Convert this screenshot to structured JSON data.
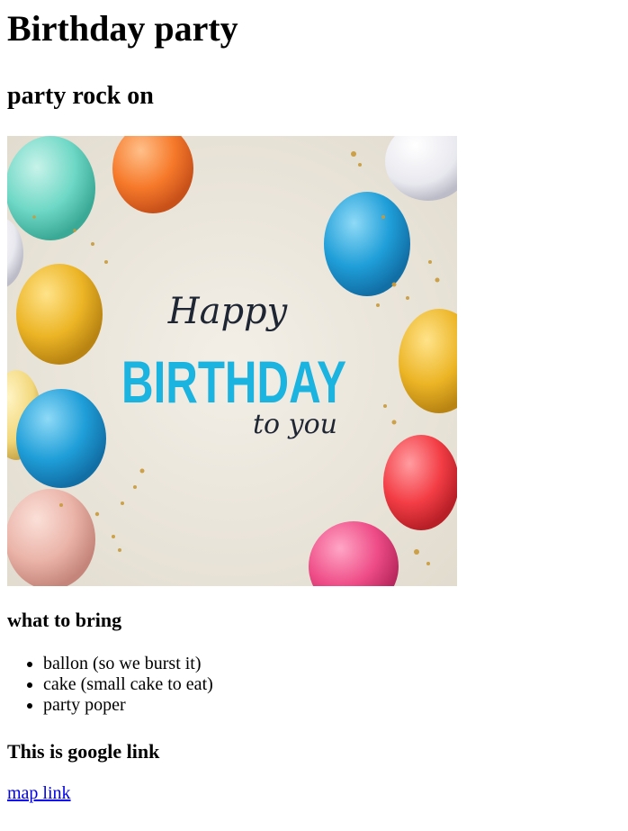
{
  "page": {
    "title": "Birthday party",
    "subtitle": "party rock on"
  },
  "hero_image": {
    "icon": "birthday-balloons-image",
    "text_happy": "Happy",
    "text_birthday": "BIRTHDAY",
    "text_to_you": "to you",
    "colors": {
      "background": "#ece6dc",
      "birthday_text": "#1bb3df",
      "teal": "#6fd8c6",
      "orange": "#f6792a",
      "yellow": "#ecb526",
      "blue": "#1f9ed8",
      "pink": "#ee4c86",
      "red": "#f33d45",
      "silver": "#e8e8ef",
      "peach": "#eab3a8"
    }
  },
  "bring": {
    "heading": "what to bring",
    "items": [
      "ballon (so we burst it)",
      "cake (small cake to eat)",
      "party poper"
    ]
  },
  "google": {
    "heading": "This is google link",
    "link_text": "map link"
  }
}
